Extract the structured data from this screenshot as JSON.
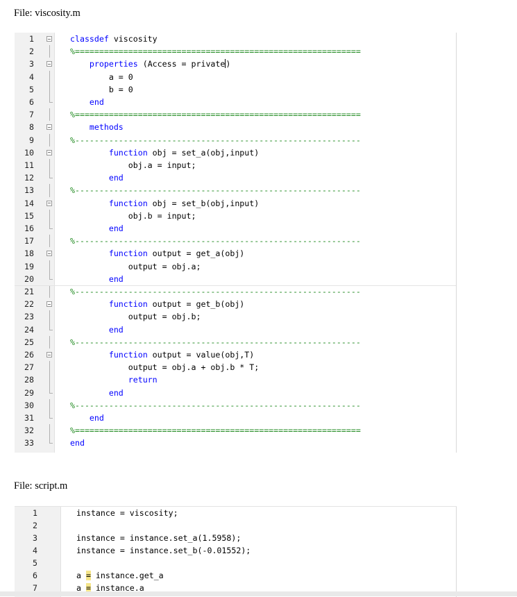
{
  "file1": {
    "label": "File: viscosity.m",
    "lines": [
      {
        "n": "1",
        "segs": [
          {
            "t": "classdef",
            "c": "kw"
          },
          {
            "t": " viscosity",
            "c": ""
          }
        ],
        "fold": "box"
      },
      {
        "n": "2",
        "segs": [
          {
            "t": "%===========================================================",
            "c": "cm"
          }
        ],
        "fold": "line"
      },
      {
        "n": "3",
        "segs": [
          {
            "t": "    ",
            "c": ""
          },
          {
            "t": "properties",
            "c": "kw"
          },
          {
            "t": " (Access = private",
            "c": ""
          },
          {
            "t": "|cursor|",
            "c": "cursor"
          },
          {
            "t": ")",
            "c": ""
          }
        ],
        "fold": "box"
      },
      {
        "n": "4",
        "segs": [
          {
            "t": "        a = 0",
            "c": ""
          }
        ],
        "fold": "line"
      },
      {
        "n": "5",
        "segs": [
          {
            "t": "        b = 0",
            "c": ""
          }
        ],
        "fold": "line"
      },
      {
        "n": "6",
        "segs": [
          {
            "t": "    ",
            "c": ""
          },
          {
            "t": "end",
            "c": "kw"
          }
        ],
        "fold": "end"
      },
      {
        "n": "7",
        "segs": [
          {
            "t": "%===========================================================",
            "c": "cm"
          }
        ],
        "fold": "line"
      },
      {
        "n": "8",
        "segs": [
          {
            "t": "    ",
            "c": ""
          },
          {
            "t": "methods",
            "c": "kw"
          }
        ],
        "fold": "box"
      },
      {
        "n": "9",
        "segs": [
          {
            "t": "%-----------------------------------------------------------",
            "c": "cm"
          }
        ],
        "fold": "line"
      },
      {
        "n": "10",
        "segs": [
          {
            "t": "        ",
            "c": ""
          },
          {
            "t": "function",
            "c": "kw"
          },
          {
            "t": " obj = set_a(obj,input)",
            "c": ""
          }
        ],
        "fold": "box"
      },
      {
        "n": "11",
        "segs": [
          {
            "t": "            obj.a = input;",
            "c": ""
          }
        ],
        "fold": "line"
      },
      {
        "n": "12",
        "segs": [
          {
            "t": "        ",
            "c": ""
          },
          {
            "t": "end",
            "c": "kw"
          }
        ],
        "fold": "end"
      },
      {
        "n": "13",
        "segs": [
          {
            "t": "%-----------------------------------------------------------",
            "c": "cm"
          }
        ],
        "fold": "line"
      },
      {
        "n": "14",
        "segs": [
          {
            "t": "        ",
            "c": ""
          },
          {
            "t": "function",
            "c": "kw"
          },
          {
            "t": " obj = set_b(obj,input)",
            "c": ""
          }
        ],
        "fold": "box"
      },
      {
        "n": "15",
        "segs": [
          {
            "t": "            obj.b = input;",
            "c": ""
          }
        ],
        "fold": "line"
      },
      {
        "n": "16",
        "segs": [
          {
            "t": "        ",
            "c": ""
          },
          {
            "t": "end",
            "c": "kw"
          }
        ],
        "fold": "end"
      },
      {
        "n": "17",
        "segs": [
          {
            "t": "%-----------------------------------------------------------",
            "c": "cm"
          }
        ],
        "fold": "line"
      },
      {
        "n": "18",
        "segs": [
          {
            "t": "        ",
            "c": ""
          },
          {
            "t": "function",
            "c": "kw"
          },
          {
            "t": " output = get_a(obj)",
            "c": ""
          }
        ],
        "fold": "box"
      },
      {
        "n": "19",
        "segs": [
          {
            "t": "            output = obj.a;",
            "c": ""
          }
        ],
        "fold": "line"
      },
      {
        "n": "20",
        "segs": [
          {
            "t": "        ",
            "c": ""
          },
          {
            "t": "end",
            "c": "kw"
          }
        ],
        "fold": "end"
      },
      {
        "n": "21",
        "segs": [
          {
            "t": "%-----------------------------------------------------------",
            "c": "cm"
          }
        ],
        "fold": "line"
      },
      {
        "n": "22",
        "segs": [
          {
            "t": "        ",
            "c": ""
          },
          {
            "t": "function",
            "c": "kw"
          },
          {
            "t": " output = get_b(obj)",
            "c": ""
          }
        ],
        "fold": "box"
      },
      {
        "n": "23",
        "segs": [
          {
            "t": "            output = obj.b;",
            "c": ""
          }
        ],
        "fold": "line"
      },
      {
        "n": "24",
        "segs": [
          {
            "t": "        ",
            "c": ""
          },
          {
            "t": "end",
            "c": "kw"
          }
        ],
        "fold": "end"
      },
      {
        "n": "25",
        "segs": [
          {
            "t": "%-----------------------------------------------------------",
            "c": "cm"
          }
        ],
        "fold": "line"
      },
      {
        "n": "26",
        "segs": [
          {
            "t": "        ",
            "c": ""
          },
          {
            "t": "function",
            "c": "kw"
          },
          {
            "t": " output = value(obj,T)",
            "c": ""
          }
        ],
        "fold": "box"
      },
      {
        "n": "27",
        "segs": [
          {
            "t": "            output = obj.a + obj.b * T;",
            "c": ""
          }
        ],
        "fold": "line"
      },
      {
        "n": "28",
        "segs": [
          {
            "t": "            ",
            "c": ""
          },
          {
            "t": "return",
            "c": "kw"
          }
        ],
        "fold": "line"
      },
      {
        "n": "29",
        "segs": [
          {
            "t": "        ",
            "c": ""
          },
          {
            "t": "end",
            "c": "kw"
          }
        ],
        "fold": "end"
      },
      {
        "n": "30",
        "segs": [
          {
            "t": "%-----------------------------------------------------------",
            "c": "cm"
          }
        ],
        "fold": "line"
      },
      {
        "n": "31",
        "segs": [
          {
            "t": "    ",
            "c": ""
          },
          {
            "t": "end",
            "c": "kw"
          }
        ],
        "fold": "end"
      },
      {
        "n": "32",
        "segs": [
          {
            "t": "%===========================================================",
            "c": "cm"
          }
        ],
        "fold": "line"
      },
      {
        "n": "33",
        "segs": [
          {
            "t": "end",
            "c": "kw"
          }
        ],
        "fold": "end"
      }
    ]
  },
  "file2": {
    "label": "File: script.m",
    "lines": [
      {
        "n": "1",
        "segs": [
          {
            "t": "instance = viscosity;",
            "c": ""
          }
        ]
      },
      {
        "n": "2",
        "segs": [
          {
            "t": "",
            "c": ""
          }
        ]
      },
      {
        "n": "3",
        "segs": [
          {
            "t": "instance = instance.set_a(1.5958);",
            "c": ""
          }
        ]
      },
      {
        "n": "4",
        "segs": [
          {
            "t": "instance = instance.set_b(-0.01552);",
            "c": ""
          }
        ]
      },
      {
        "n": "5",
        "segs": [
          {
            "t": "",
            "c": ""
          }
        ]
      },
      {
        "n": "6",
        "segs": [
          {
            "t": "a ",
            "c": ""
          },
          {
            "t": "=",
            "c": "hl-eq"
          },
          {
            "t": " instance.get_a",
            "c": ""
          }
        ]
      },
      {
        "n": "7",
        "segs": [
          {
            "t": "a ",
            "c": ""
          },
          {
            "t": "=",
            "c": "hl-eq"
          },
          {
            "t": " instance.a",
            "c": ""
          }
        ]
      }
    ]
  },
  "colors": {
    "keyword": "#0000ff",
    "comment": "#228b22",
    "gutter": "#f1f1f1",
    "highlight": "#f5e58a"
  }
}
